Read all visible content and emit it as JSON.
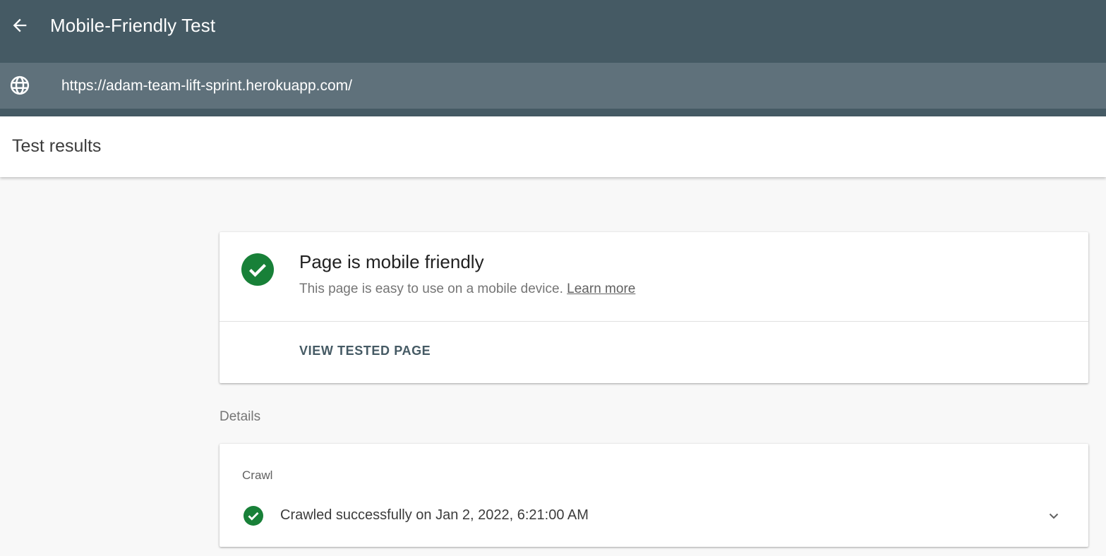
{
  "app": {
    "title": "Mobile-Friendly Test",
    "back_icon": "arrow-back-icon"
  },
  "url_bar": {
    "icon": "globe-icon",
    "value": "https://adam-team-lift-sprint.herokuapp.com/"
  },
  "results": {
    "title": "Test results"
  },
  "summary": {
    "icon": "check-circle-icon",
    "title": "Page is mobile friendly",
    "description": "This page is easy to use on a mobile device.",
    "learn_more": "Learn more",
    "view_button": "VIEW TESTED PAGE"
  },
  "details": {
    "label": "Details",
    "crawl": {
      "section_label": "Crawl",
      "icon": "check-circle-icon",
      "status": "Crawled successfully on Jan 2, 2022, 6:21:00 AM",
      "expand_icon": "chevron-down-icon"
    }
  },
  "colors": {
    "header": "#455a64",
    "url_bar": "#5f717b",
    "success": "#188038",
    "page_bg": "#f8f8f8"
  }
}
